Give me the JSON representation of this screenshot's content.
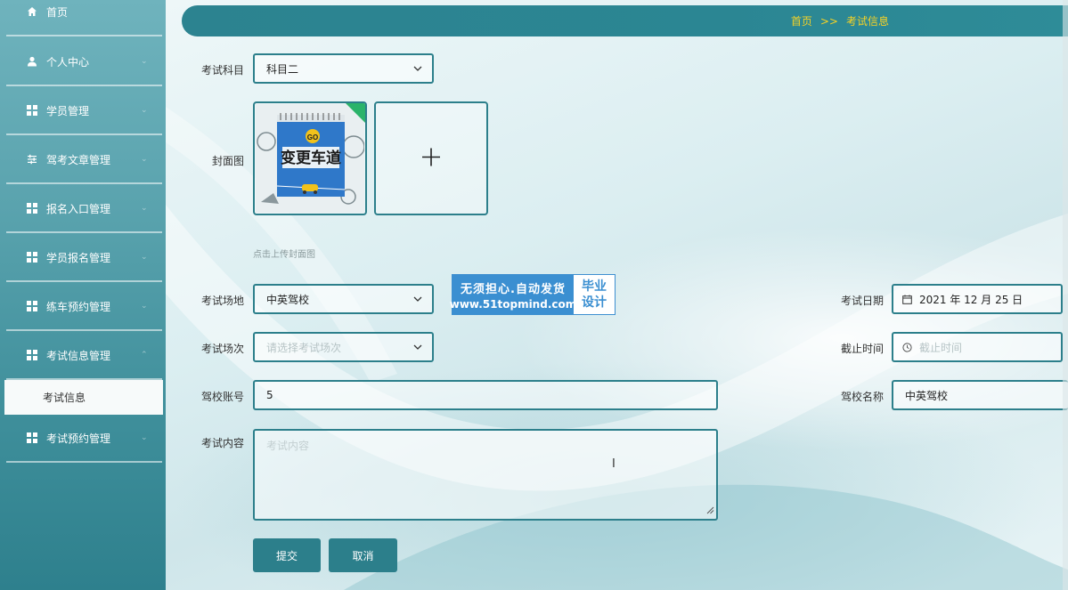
{
  "sidebar": {
    "items": [
      {
        "label": "首页"
      },
      {
        "label": "个人中心"
      },
      {
        "label": "学员管理"
      },
      {
        "label": "驾考文章管理"
      },
      {
        "label": "报名入口管理"
      },
      {
        "label": "学员报名管理"
      },
      {
        "label": "练车预约管理"
      },
      {
        "label": "考试信息管理"
      },
      {
        "label": "考试预约管理"
      }
    ],
    "active_sub": "考试信息"
  },
  "breadcrumb": {
    "home": "首页",
    "separator": ">>",
    "current": "考试信息"
  },
  "form": {
    "subject": {
      "label": "考试科目",
      "value": "科目二"
    },
    "cover": {
      "label": "封面图",
      "hint": "点击上传封面图",
      "image_title": "变更车道",
      "image_badge": "GO"
    },
    "venue": {
      "label": "考试场地",
      "value": "中英驾校"
    },
    "session": {
      "label": "考试场次",
      "placeholder": "请选择考试场次"
    },
    "date": {
      "label": "考试日期",
      "value": "2021 年 12 月 25 日"
    },
    "deadline": {
      "label": "截止时间",
      "placeholder": "截止时间"
    },
    "account": {
      "label": "驾校账号",
      "value": "5"
    },
    "school_name": {
      "label": "驾校名称",
      "value": "中英驾校"
    },
    "content": {
      "label": "考试内容",
      "placeholder": "考试内容"
    },
    "submit": "提交",
    "cancel": "取消"
  },
  "watermark": {
    "line1": "无须担心.自动发货",
    "line2": "www.51topmind.com",
    "badge1": "毕业",
    "badge2": "设计"
  },
  "colors": {
    "accent": "#2c7f8b",
    "breadcrumb_text": "#f5d226",
    "watermark": "#3b8fd1"
  }
}
